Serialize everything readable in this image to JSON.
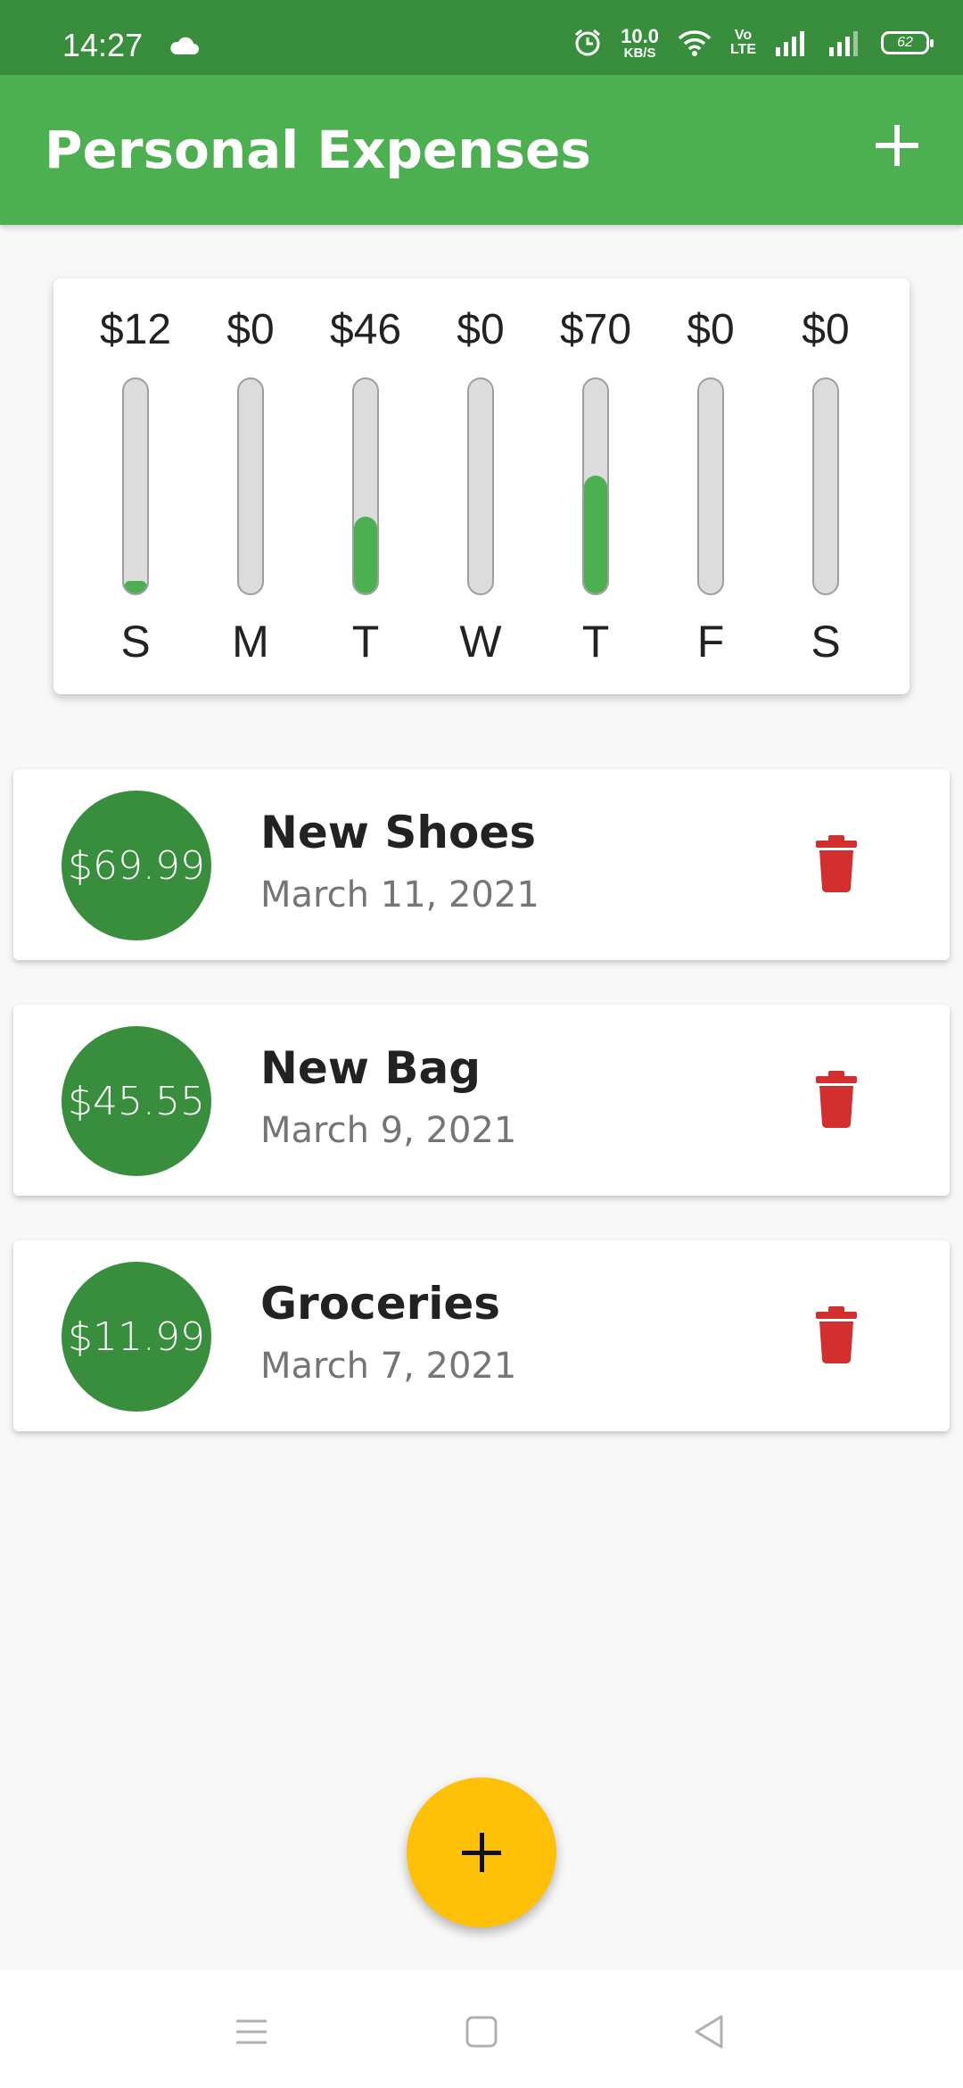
{
  "status_bar": {
    "time": "14:27",
    "speed_value": "10.0",
    "speed_unit": "KB/S",
    "volte_top": "Vo",
    "volte_bottom": "LTE",
    "battery": "62",
    "icons": [
      "cloud-icon",
      "alarm-icon",
      "wifi-icon",
      "signal-icon",
      "signal-icon",
      "battery-icon"
    ]
  },
  "app_bar": {
    "title": "Personal Expenses",
    "add_icon": "plus-icon"
  },
  "chart": {
    "days": [
      {
        "label": "S",
        "amount": "$12",
        "fraction": 0.06
      },
      {
        "label": "M",
        "amount": "$0",
        "fraction": 0
      },
      {
        "label": "T",
        "amount": "$46",
        "fraction": 0.36
      },
      {
        "label": "W",
        "amount": "$0",
        "fraction": 0
      },
      {
        "label": "T",
        "amount": "$70",
        "fraction": 0.55
      },
      {
        "label": "F",
        "amount": "$0",
        "fraction": 0
      },
      {
        "label": "S",
        "amount": "$0",
        "fraction": 0
      }
    ],
    "colors": {
      "fill": "#4caf50",
      "track": "#dcdcdc"
    }
  },
  "transactions": [
    {
      "amount": "$69.99",
      "title": "New Shoes",
      "date": "March 11, 2021"
    },
    {
      "amount": "$45.55",
      "title": "New Bag",
      "date": "March 9, 2021"
    },
    {
      "amount": "$11.99",
      "title": "Groceries",
      "date": "March 7, 2021"
    }
  ],
  "fab_icon": "plus-icon",
  "nav": {
    "icons": [
      "menu-icon",
      "home-icon",
      "back-icon"
    ]
  },
  "colors": {
    "primary": "#4caf50",
    "primary_dark": "#388e3c",
    "accent": "#ffc107",
    "delete": "#d32f2f"
  }
}
